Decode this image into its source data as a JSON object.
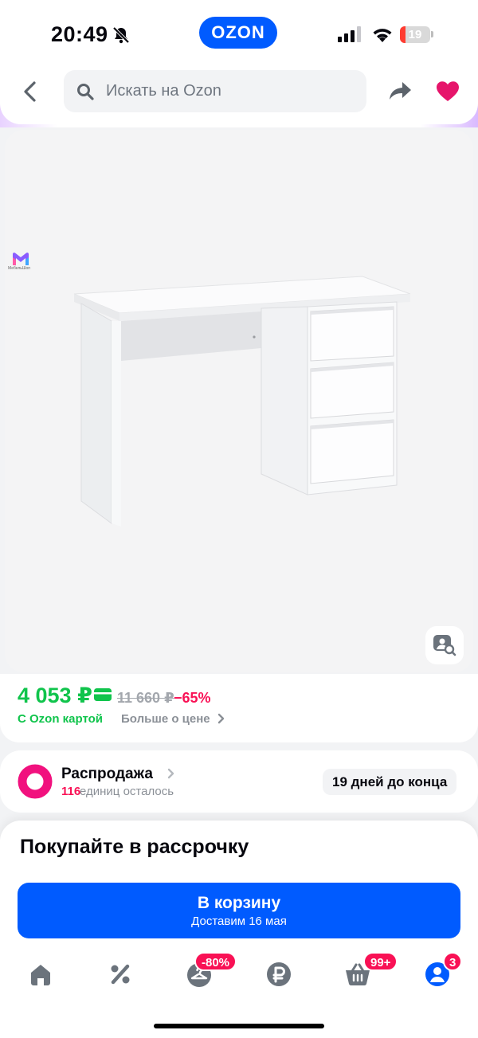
{
  "status_bar": {
    "time": "20:49",
    "battery": "19",
    "battery_level": 0.19,
    "icons": [
      "bell-off-icon",
      "signal-icon",
      "wifi-icon",
      "battery-icon"
    ]
  },
  "app": {
    "logo": "OZON",
    "brand_color": "#005bff"
  },
  "header": {
    "search_placeholder": "Искать на Ozon",
    "icons": [
      "back-icon",
      "search-icon",
      "share-icon",
      "heart-icon"
    ]
  },
  "gallery": {
    "image": "white-desk-with-drawers",
    "brand_caption": "МебельШоп",
    "image_search_icon": "image-search-icon"
  },
  "price": {
    "current": "4 053 ₽",
    "old": "11 660 ₽",
    "discount": "−65%",
    "ozon_card_label": "С Ozon картой",
    "more_link": "Больше о цене",
    "price_color": "#10c44c",
    "discount_color": "#f91155"
  },
  "sale": {
    "title": "Распродажа",
    "count": "116",
    "count_text": "единиц осталось",
    "days_left": "19 дней до конца"
  },
  "installment": {
    "title": "Покупайте в рассрочку"
  },
  "cart_button": {
    "label": "В корзину",
    "delivery": "Доставим 16 мая"
  },
  "tab_bar": {
    "tabs": [
      {
        "icon": "home-icon"
      },
      {
        "icon": "percent-icon"
      },
      {
        "icon": "hanger-icon",
        "badge": "-80%"
      },
      {
        "icon": "ruble-icon"
      },
      {
        "icon": "basket-icon",
        "badge": "99+"
      },
      {
        "icon": "profile-icon",
        "badge": "3"
      }
    ]
  }
}
